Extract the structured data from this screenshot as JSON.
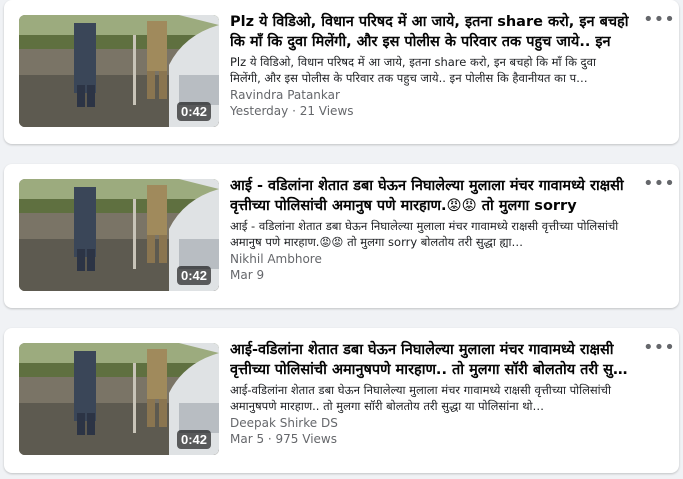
{
  "results": [
    {
      "duration": "0:42",
      "title": "Plz ये विडिओ, विधान परिषद में आ जाये, इतना share करो, इन बचहो कि माँ कि दुवा मिलेंगी, और इस पोलीस के परिवार तक पहुच जाये.. इन पोली…",
      "description": "Plz ये विडिओ, विधान परिषद में आ जाये, इतना share करो, इन बचहो कि माँ कि दुवा मिलेंगी, और इस पोलीस के परिवार तक पहुच जाये.. इन पोलीस कि हैवानीयत का प…",
      "author": "Ravindra Patankar",
      "meta": "Yesterday · 21 Views"
    },
    {
      "duration": "0:42",
      "title": "आई - वडिलांना शेतात डबा घेऊन निघालेल्या मुलाला मंचर गावामध्ये राक्षसी वृत्तीच्या पोलिसांची अमानुष पणे मारहाण.😡😡 तो मुलगा sorry बोलतो…",
      "description": "आई - वडिलांना शेतात डबा घेऊन निघालेल्या मुलाला मंचर गावामध्ये राक्षसी वृत्तीच्या पोलिसांची अमानुष पणे मारहाण.😡😡 तो मुलगा sorry बोलतोय तरी सुद्धा ह्या…",
      "author": "Nikhil Ambhore",
      "meta": "Mar 9"
    },
    {
      "duration": "0:42",
      "title": "आई-वडिलांना शेतात डबा घेऊन निघालेल्या मुलाला मंचर गावामध्ये राक्षसी वृत्तीच्या पोलिसांची अमानुषपणे मारहाण.. तो मुलगा सॉरी बोलतोय तरी सु…",
      "description": "आई-वडिलांना शेतात डबा घेऊन निघालेल्या मुलाला मंचर गावामध्ये राक्षसी वृत्तीच्या पोलिसांची अमानुषपणे मारहाण.. तो मुलगा सॉरी बोलतोय तरी सुद्धा या पोलिसांना थो…",
      "author": "Deepak Shirke DS",
      "meta": "Mar 5 · 975 Views"
    }
  ],
  "more_icon": "more-horizontal-icon",
  "colors": {
    "background": "#f0f2f5",
    "card": "#ffffff",
    "secondary_text": "#65676b"
  }
}
